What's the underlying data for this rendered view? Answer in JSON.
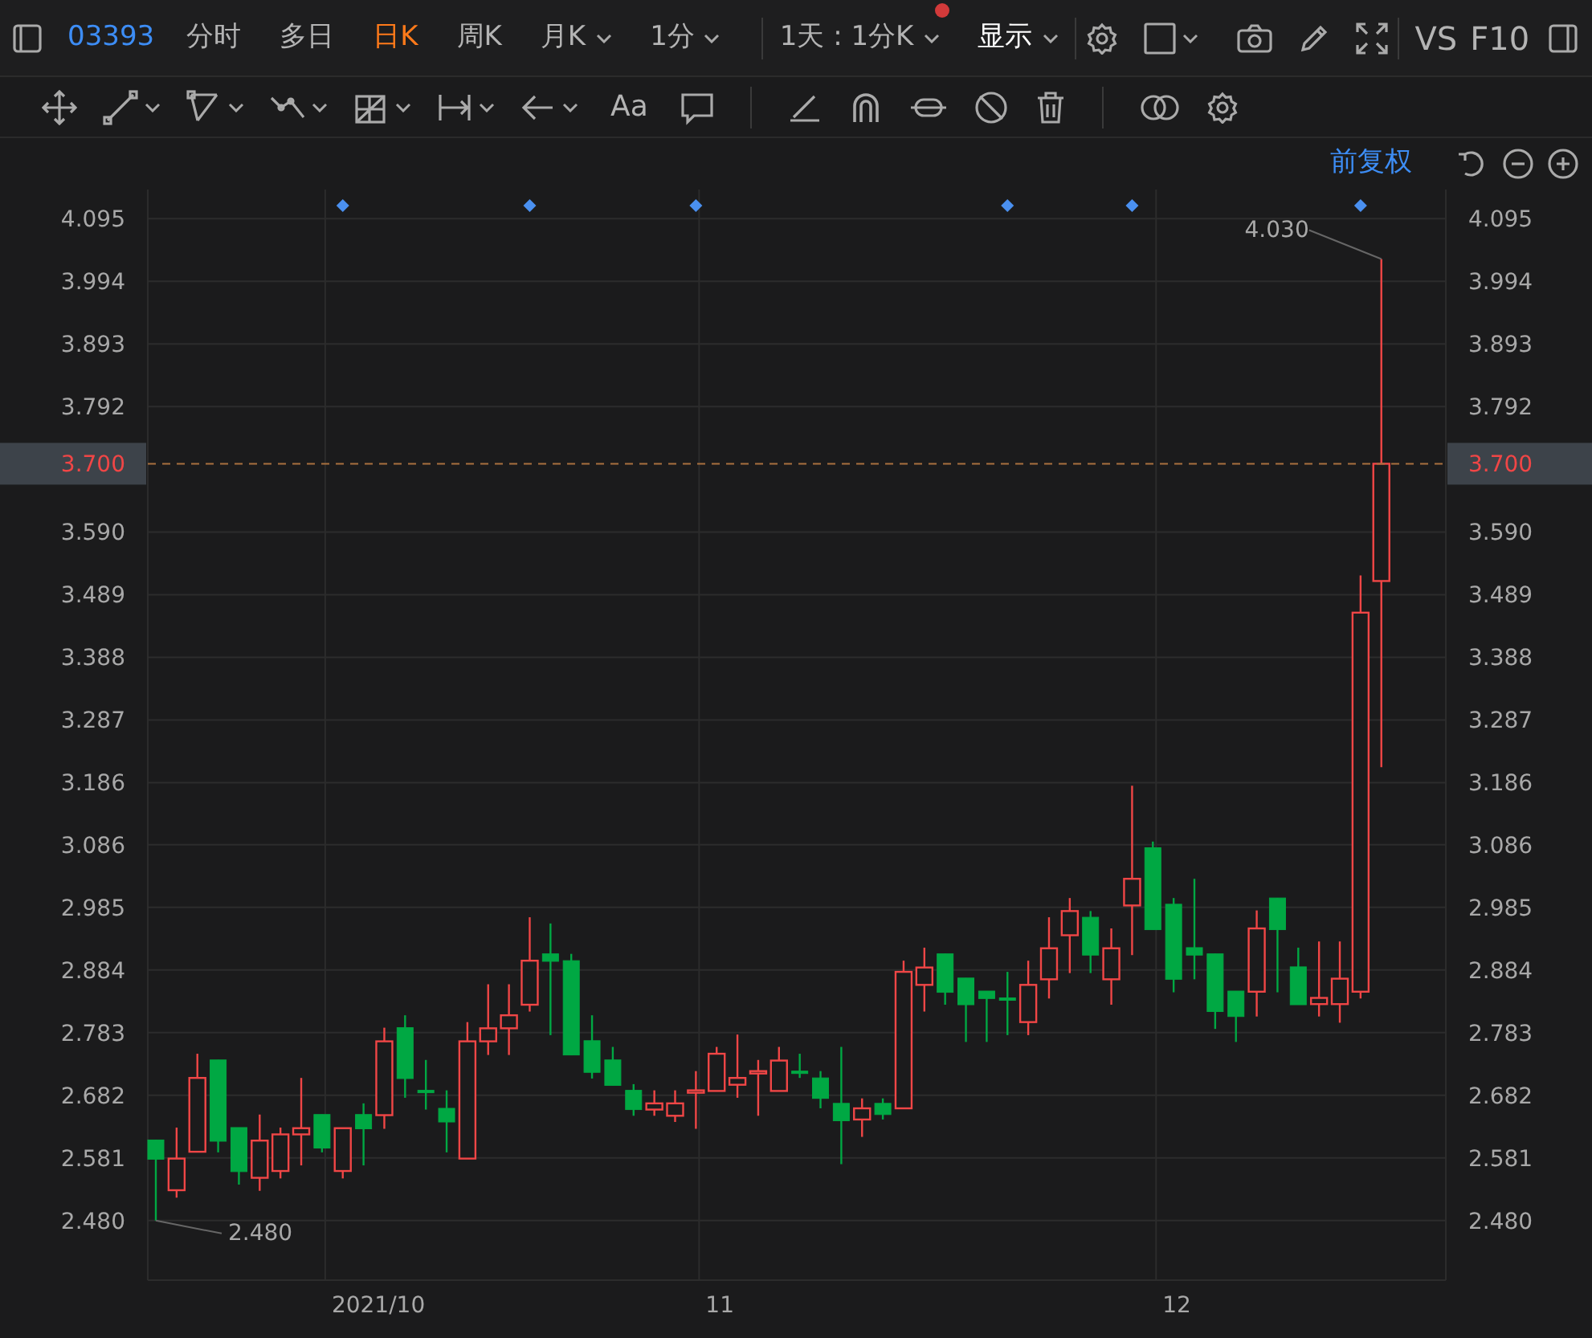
{
  "toolbar": {
    "code": "03393",
    "periods": [
      {
        "label": "分时",
        "selected": false,
        "dropdown": false
      },
      {
        "label": "多日",
        "selected": false,
        "dropdown": false
      },
      {
        "label": "日K",
        "selected": true,
        "dropdown": false
      },
      {
        "label": "周K",
        "selected": false,
        "dropdown": false
      },
      {
        "label": "月K",
        "selected": false,
        "dropdown": true
      },
      {
        "label": "1分",
        "selected": false,
        "dropdown": true
      }
    ],
    "range_menu": {
      "label": "1天 : 1分K",
      "notification": true
    },
    "display_menu": {
      "label": "显示"
    },
    "compare_label": "VS",
    "f10_label": "F10"
  },
  "drawing_tools": {
    "text_tool_label": "Aa"
  },
  "chart_header": {
    "adjust_label": "前复权"
  },
  "chart": {
    "chart_data": {
      "type": "candlestick",
      "ylim": [
        2.384,
        4.142
      ],
      "grid": true,
      "yticks": [
        {
          "value": 4.095,
          "label": "4.095"
        },
        {
          "value": 3.994,
          "label": "3.994"
        },
        {
          "value": 3.893,
          "label": "3.893"
        },
        {
          "value": 3.792,
          "label": "3.792"
        },
        {
          "value": 3.59,
          "label": "3.590"
        },
        {
          "value": 3.489,
          "label": "3.489"
        },
        {
          "value": 3.388,
          "label": "3.388"
        },
        {
          "value": 3.287,
          "label": "3.287"
        },
        {
          "value": 3.186,
          "label": "3.186"
        },
        {
          "value": 3.086,
          "label": "3.086"
        },
        {
          "value": 2.985,
          "label": "2.985"
        },
        {
          "value": 2.884,
          "label": "2.884"
        },
        {
          "value": 2.783,
          "label": "2.783"
        },
        {
          "value": 2.682,
          "label": "2.682"
        },
        {
          "value": 2.581,
          "label": "2.581"
        },
        {
          "value": 2.48,
          "label": "2.480"
        }
      ],
      "ohlc": [
        [
          2.61,
          2.61,
          2.48,
          2.579
        ],
        [
          2.529,
          2.63,
          2.517,
          2.58
        ],
        [
          2.591,
          2.749,
          2.591,
          2.71
        ],
        [
          2.739,
          2.739,
          2.59,
          2.608
        ],
        [
          2.63,
          2.63,
          2.538,
          2.559
        ],
        [
          2.549,
          2.651,
          2.528,
          2.609
        ],
        [
          2.56,
          2.63,
          2.548,
          2.619
        ],
        [
          2.619,
          2.71,
          2.569,
          2.629
        ],
        [
          2.651,
          2.651,
          2.59,
          2.597
        ],
        [
          2.56,
          2.629,
          2.548,
          2.629
        ],
        [
          2.651,
          2.669,
          2.569,
          2.628
        ],
        [
          2.65,
          2.791,
          2.628,
          2.769
        ],
        [
          2.791,
          2.811,
          2.678,
          2.709
        ],
        [
          2.69,
          2.739,
          2.659,
          2.689
        ],
        [
          2.661,
          2.69,
          2.59,
          2.639
        ],
        [
          2.58,
          2.8,
          2.58,
          2.769
        ],
        [
          2.769,
          2.861,
          2.747,
          2.79
        ],
        [
          2.79,
          2.861,
          2.747,
          2.811
        ],
        [
          2.828,
          2.969,
          2.817,
          2.899
        ],
        [
          2.91,
          2.959,
          2.779,
          2.898
        ],
        [
          2.899,
          2.91,
          2.747,
          2.747
        ],
        [
          2.77,
          2.811,
          2.709,
          2.719
        ],
        [
          2.739,
          2.76,
          2.698,
          2.698
        ],
        [
          2.69,
          2.7,
          2.649,
          2.659
        ],
        [
          2.659,
          2.69,
          2.649,
          2.669
        ],
        [
          2.649,
          2.69,
          2.639,
          2.669
        ],
        [
          2.689,
          2.721,
          2.628,
          2.69
        ],
        [
          2.689,
          2.76,
          2.689,
          2.749
        ],
        [
          2.699,
          2.78,
          2.678,
          2.71
        ],
        [
          2.72,
          2.739,
          2.649,
          2.721
        ],
        [
          2.689,
          2.76,
          2.689,
          2.738
        ],
        [
          2.721,
          2.749,
          2.71,
          2.72
        ],
        [
          2.71,
          2.721,
          2.661,
          2.677
        ],
        [
          2.669,
          2.76,
          2.571,
          2.641
        ],
        [
          2.643,
          2.677,
          2.615,
          2.661
        ],
        [
          2.669,
          2.677,
          2.643,
          2.651
        ],
        [
          2.661,
          2.899,
          2.661,
          2.881
        ],
        [
          2.86,
          2.92,
          2.817,
          2.888
        ],
        [
          2.91,
          2.91,
          2.828,
          2.848
        ],
        [
          2.871,
          2.871,
          2.768,
          2.828
        ],
        [
          2.85,
          2.85,
          2.768,
          2.838
        ],
        [
          2.839,
          2.881,
          2.779,
          2.838
        ],
        [
          2.8,
          2.899,
          2.779,
          2.86
        ],
        [
          2.869,
          2.969,
          2.838,
          2.919
        ],
        [
          2.94,
          3.0,
          2.879,
          2.979
        ],
        [
          2.969,
          2.979,
          2.879,
          2.908
        ],
        [
          2.869,
          2.951,
          2.828,
          2.919
        ],
        [
          2.988,
          3.181,
          2.908,
          3.031
        ],
        [
          3.081,
          3.091,
          2.949,
          2.949
        ],
        [
          2.99,
          3.0,
          2.848,
          2.869
        ],
        [
          2.92,
          3.031,
          2.869,
          2.908
        ],
        [
          2.91,
          2.91,
          2.789,
          2.817
        ],
        [
          2.85,
          2.85,
          2.768,
          2.809
        ],
        [
          2.849,
          2.98,
          2.809,
          2.951
        ],
        [
          3.0,
          3.0,
          2.848,
          2.949
        ],
        [
          2.889,
          2.92,
          2.828,
          2.828
        ],
        [
          2.829,
          2.93,
          2.809,
          2.839
        ],
        [
          2.829,
          2.93,
          2.799,
          2.87
        ],
        [
          2.849,
          3.52,
          2.838,
          3.46
        ],
        [
          3.511,
          4.03,
          3.211,
          3.7
        ]
      ],
      "ref_lines": [
        {
          "axis": "y",
          "value": 3.7,
          "label": "3.700"
        }
      ],
      "annotations": [
        "4.030",
        "2.480"
      ]
    },
    "month_labels": [
      "2021/10",
      "11",
      "12"
    ],
    "right_axis": {
      "labels": [
        "4.095",
        "3.994",
        "3.893",
        "3.792",
        "3.590",
        "3.489",
        "3.388",
        "3.287",
        "3.186",
        "3.086",
        "2.985",
        "2.884",
        "2.783",
        "2.682",
        "2.581",
        "2.480"
      ],
      "current_label": "3.700"
    }
  }
}
